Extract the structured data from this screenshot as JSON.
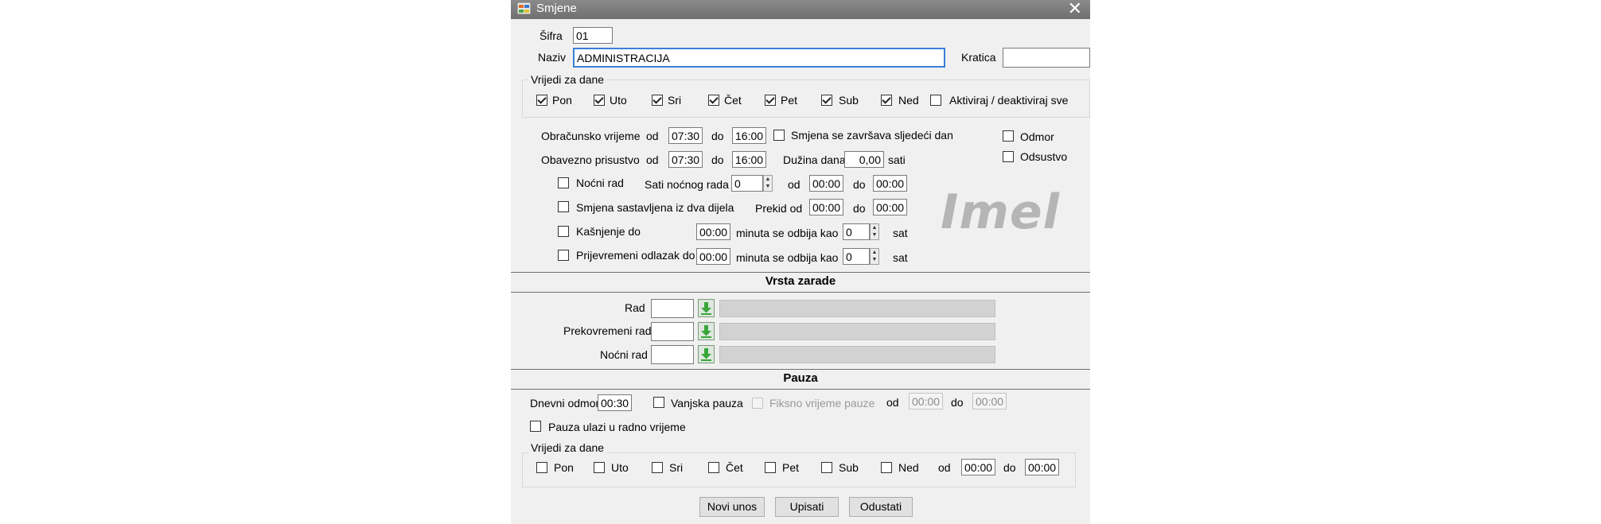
{
  "window": {
    "title": "Smjene",
    "close_glyph": "✕"
  },
  "header": {
    "sifra_label": "Šifra",
    "sifra_value": "01",
    "naziv_label": "Naziv",
    "naziv_value": "ADMINISTRACIJA",
    "kratica_label": "Kratica",
    "kratica_value": ""
  },
  "days_group": {
    "title": "Vrijedi za dane",
    "days": [
      {
        "label": "Pon",
        "checked": true
      },
      {
        "label": "Uto",
        "checked": true
      },
      {
        "label": "Sri",
        "checked": true
      },
      {
        "label": "Čet",
        "checked": true
      },
      {
        "label": "Pet",
        "checked": true
      },
      {
        "label": "Sub",
        "checked": true
      },
      {
        "label": "Ned",
        "checked": true
      }
    ],
    "toggle_all_label": "Aktiviraj / deaktiviraj sve"
  },
  "times": {
    "obracunsko_label": "Obračunsko vrijeme",
    "od": "od",
    "do": "do",
    "obracunsko_od": "07:30",
    "obracunsko_do": "16:00",
    "ends_next_day_label": "Smjena se završava sljedeći dan",
    "obavezno_label": "Obavezno prisustvo",
    "obavezno_od": "07:30",
    "obavezno_do": "16:00",
    "duzina_label": "Dužina dana",
    "duzina_value": "0,00",
    "sati": "sati",
    "odmor_label": "Odmor",
    "odsustvo_label": "Odsustvo",
    "nocni_rad_label": "Noćni rad",
    "sati_nocnog_label": "Sati noćnog rada",
    "sati_nocnog_value": "0",
    "nocni_od": "00:00",
    "nocni_do": "00:00",
    "dva_dijela_label": "Smjena sastavljena iz dva dijela",
    "prekid_od_label": "Prekid od",
    "prekid_od": "00:00",
    "prekid_do": "00:00",
    "kasnjenje_label": "Kašnjenje do",
    "kasnjenje_value": "00:00",
    "minuta_odbija_label": "minuta se odbija kao",
    "kasnjenje_sat": "0",
    "sat": "sat",
    "prijevremeni_label": "Prijevremeni odlazak do",
    "prijevremeni_value": "00:00",
    "prijevremeni_sat": "0"
  },
  "logo_text": "Imel",
  "vrsta_zarade": {
    "title": "Vrsta zarade",
    "rows": [
      {
        "label": "Rad",
        "code": "",
        "name": ""
      },
      {
        "label": "Prekovremeni rad",
        "code": "",
        "name": ""
      },
      {
        "label": "Noćni rad",
        "code": "",
        "name": ""
      }
    ]
  },
  "pauza": {
    "title": "Pauza",
    "dnevni_odmor_label": "Dnevni odmor",
    "dnevni_odmor_value": "00:30",
    "vanjska_label": "Vanjska pauza",
    "fiksno_label": "Fiksno vrijeme pauze",
    "od": "od",
    "do": "do",
    "fiksno_od": "00:00",
    "fiksno_do": "00:00",
    "ulazi_label": "Pauza ulazi u radno vrijeme",
    "days_title": "Vrijedi za dane",
    "days": [
      {
        "label": "Pon",
        "checked": false
      },
      {
        "label": "Uto",
        "checked": false
      },
      {
        "label": "Sri",
        "checked": false
      },
      {
        "label": "Čet",
        "checked": false
      },
      {
        "label": "Pet",
        "checked": false
      },
      {
        "label": "Sub",
        "checked": false
      },
      {
        "label": "Ned",
        "checked": false
      }
    ],
    "days_od": "00:00",
    "days_do": "00:00"
  },
  "buttons": {
    "novi_unos": "Novi unos",
    "upisati": "Upisati",
    "odustati": "Odustati"
  },
  "colors": {
    "titlebar": "#7a7a7a",
    "window_bg": "#f0f0f0",
    "focus_border": "#3c7fd6",
    "lookup_icon": "#3aa63a"
  }
}
